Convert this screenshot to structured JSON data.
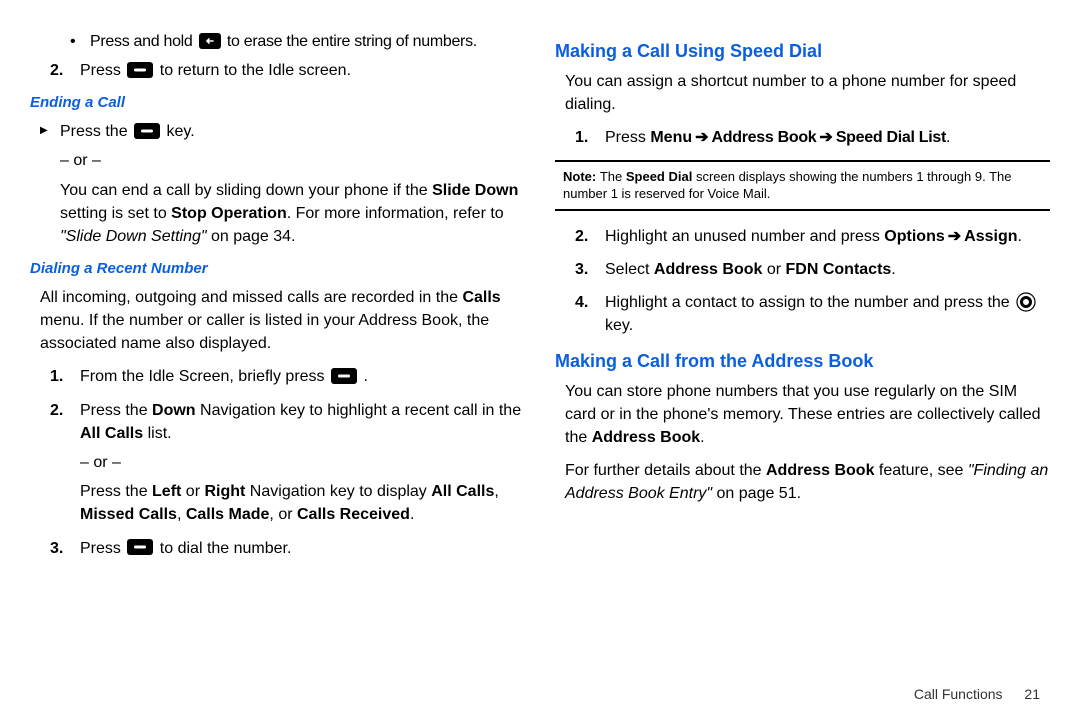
{
  "left": {
    "top_bullet": "Press and hold",
    "top_bullet_cont": " to erase the entire string of numbers.",
    "item2": "Press ",
    "item2_cont": " to return to the Idle screen.",
    "ending_heading": "Ending a Call",
    "tri_press_the": "Press the ",
    "tri_key": " key.",
    "or": "– or –",
    "end_slide": "You can end a call by sliding down your phone if the ",
    "end_slide_b1": "Slide Down",
    "end_slide_mid": " setting is set to ",
    "end_slide_b2": "Stop Operation",
    "end_slide_after": ". For more information, refer to ",
    "end_slide_ref": "\"Slide Down Setting\"",
    "end_slide_page": " on page 34.",
    "dialing_heading": "Dialing a Recent Number",
    "dialing_body_pre": "All incoming, outgoing and missed calls are recorded in the ",
    "dialing_body_b": "Calls",
    "dialing_body_post": " menu. If the number or caller is listed in your Address Book, the associated name also displayed.",
    "d1_pre": "From the Idle Screen, briefly press ",
    "d1_post": " .",
    "d2_pre": "Press the ",
    "d2_b1": "Down",
    "d2_mid": " Navigation key to highlight a recent call in the ",
    "d2_b2": "All Calls",
    "d2_post": " list.",
    "d2_alt_pre": "Press the ",
    "d2_alt_b1": "Left",
    "d2_alt_or": " or ",
    "d2_alt_b2": "Right",
    "d2_alt_mid": " Navigation key to display ",
    "d2_alt_b3": "All Calls",
    "d2_alt_c1": ", ",
    "d2_alt_b4": "Missed Calls",
    "d2_alt_c2": ", ",
    "d2_alt_b5": "Calls Made",
    "d2_alt_c3": ", or ",
    "d2_alt_b6": "Calls Received",
    "d2_alt_end": ".",
    "d3_pre": "Press ",
    "d3_post": " to dial the number."
  },
  "right": {
    "speed_heading": "Making a Call Using Speed Dial",
    "speed_body": "You can assign a shortcut number to a phone number for speed dialing.",
    "s1_pre": "Press ",
    "s1_b1": "Menu",
    "s1_b2": "Address Book",
    "s1_b3": "Speed Dial List",
    "s1_end": ".",
    "note_pre": "Note: ",
    "note_mid1": "The ",
    "note_b": "Speed Dial",
    "note_mid2": " screen displays showing the numbers 1 through 9. The number 1 is reserved for Voice Mail.",
    "s2_pre": "Highlight an unused number and press ",
    "s2_b1": "Options",
    "s2_b2": "Assign",
    "s2_end": ".",
    "s3_pre": "Select ",
    "s3_b1": "Address Book",
    "s3_or": " or ",
    "s3_b2": "FDN Contacts",
    "s3_end": ".",
    "s4_pre": "Highlight a contact to assign to the number and press the ",
    "s4_post": " key.",
    "ab_heading": "Making a Call from the Address Book",
    "ab_body_pre": "You can store phone numbers that you use regularly on the SIM card or in the phone's memory. These entries are collectively called the ",
    "ab_body_b": "Address Book",
    "ab_body_post": ".",
    "ab_ref_pre": "For further details about the ",
    "ab_ref_b": "Address Book",
    "ab_ref_mid": " feature, see ",
    "ab_ref_i": "\"Finding an Address Book Entry\"",
    "ab_ref_post": " on page 51."
  },
  "nums": {
    "n1": "1.",
    "n2": "2.",
    "n3": "3.",
    "n4": "4."
  },
  "arrow": "➔",
  "footer": {
    "section": "Call Functions",
    "page": "21"
  }
}
